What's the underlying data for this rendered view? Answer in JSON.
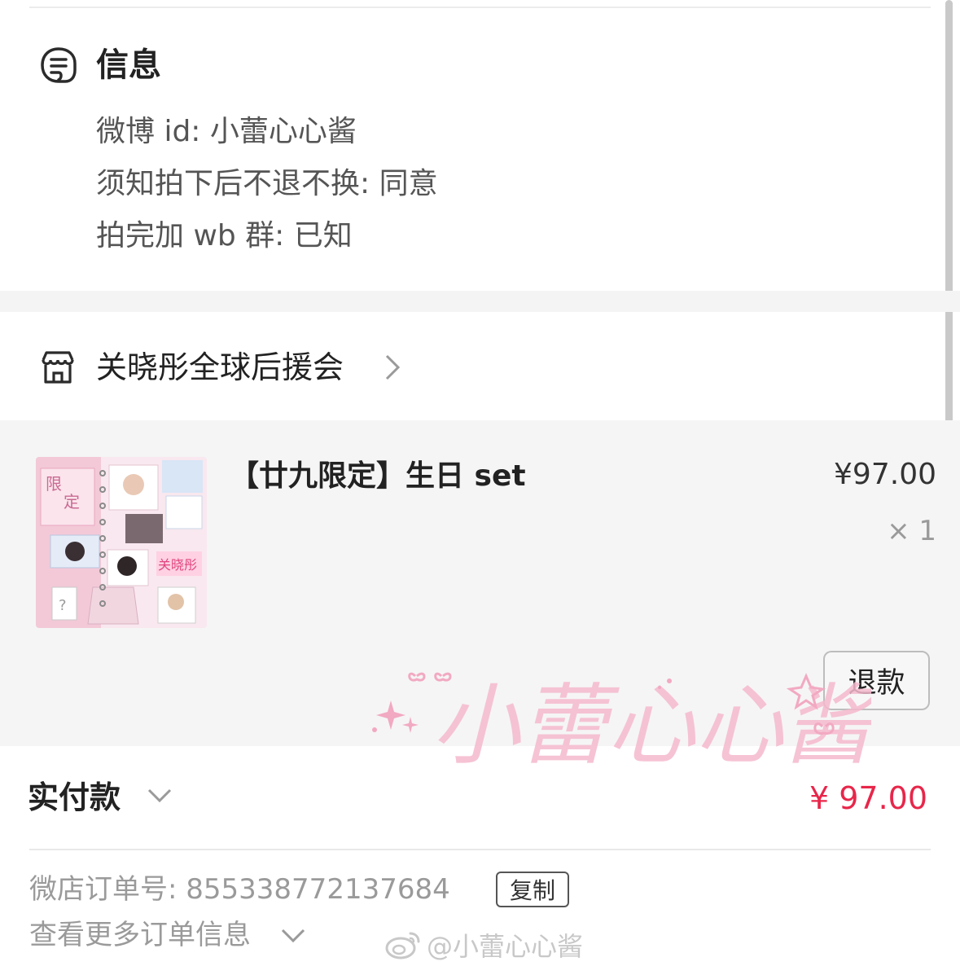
{
  "info": {
    "title": "信息",
    "icon": "message-note-icon",
    "lines": [
      "微博 id: 小蕾心心酱",
      "须知拍下后不退不换: 同意",
      "拍完加 wb 群: 已知"
    ]
  },
  "shop": {
    "name": "关晓彤全球后援会",
    "icon": "store-icon"
  },
  "product": {
    "title": "【廿九限定】生日 set",
    "price": "¥97.00",
    "quantity": "× 1",
    "refund_label": "退款"
  },
  "watermark": {
    "text": "小蕾心心酱"
  },
  "payment": {
    "label": "实付款",
    "amount": "¥ 97.00",
    "accent_color": "#e8264a"
  },
  "order": {
    "number_text": "微店订单号:  855338772137684",
    "copy_label": "复制",
    "more_label": "查看更多订单信息"
  },
  "weibo_watermark": {
    "text": "@小蕾心心酱"
  }
}
